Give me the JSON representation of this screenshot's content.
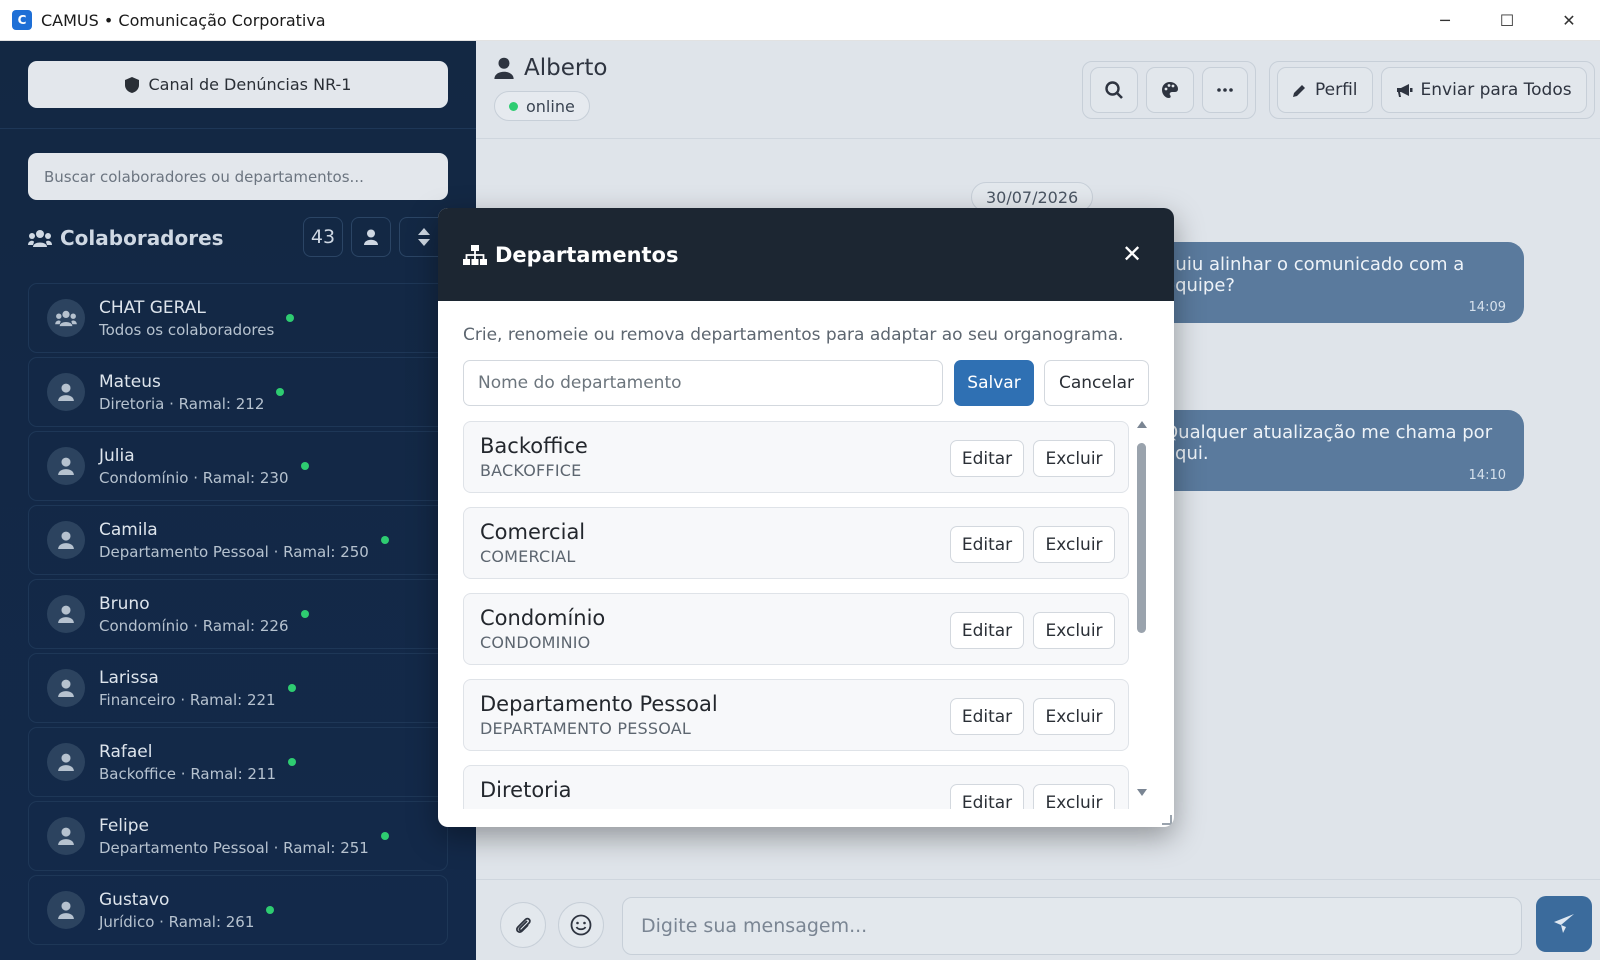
{
  "window": {
    "title": "CAMUS • Comunicação Corporativa",
    "logo_text": "C",
    "controls": {
      "minimize": "─",
      "maximize": "☐",
      "close": "✕"
    }
  },
  "sidebar": {
    "nr1_button": "Canal de Denúncias NR-1",
    "search_placeholder": "Buscar colaboradores ou departamentos...",
    "collab_title": "Colaboradores",
    "collab_count": "43",
    "contacts": [
      {
        "name": "CHAT GERAL",
        "sub": "Todos os colaboradores",
        "status": "online",
        "group": true
      },
      {
        "name": "Mateus",
        "sub": "Diretoria · Ramal: 212",
        "status": "online"
      },
      {
        "name": "Julia",
        "sub": "Condomínio · Ramal: 230",
        "status": "online"
      },
      {
        "name": "Camila",
        "sub": "Departamento Pessoal · Ramal: 250",
        "status": "online"
      },
      {
        "name": "Bruno",
        "sub": "Condomínio · Ramal: 226",
        "status": "online"
      },
      {
        "name": "Larissa",
        "sub": "Financeiro · Ramal: 221",
        "status": "online"
      },
      {
        "name": "Rafael",
        "sub": "Backoffice · Ramal: 211",
        "status": "online"
      },
      {
        "name": "Felipe",
        "sub": "Departamento Pessoal · Ramal: 251",
        "status": "online"
      },
      {
        "name": "Gustavo",
        "sub": "Jurídico · Ramal: 261",
        "status": "online"
      }
    ]
  },
  "chat": {
    "peer_name": "Alberto",
    "peer_status": "online",
    "toolbar": {
      "profile_label": "Perfil",
      "broadcast_label": "Enviar para Todos"
    },
    "date_label": "30/07/2026",
    "messages": [
      {
        "text": "guiu alinhar o comunicado com a equipe?",
        "time": "14:09"
      },
      {
        "text": "Qualquer atualização me chama por aqui.",
        "time": "14:10"
      }
    ],
    "composer_placeholder": "Digite sua mensagem..."
  },
  "modal": {
    "title": "Departamentos",
    "description": "Crie, renomeie ou remova departamentos para adaptar ao seu organograma.",
    "input_placeholder": "Nome do departamento",
    "save_label": "Salvar",
    "cancel_label": "Cancelar",
    "edit_label": "Editar",
    "delete_label": "Excluir",
    "departments": [
      {
        "name": "Backoffice",
        "code": "BACKOFFICE"
      },
      {
        "name": "Comercial",
        "code": "COMERCIAL"
      },
      {
        "name": "Condomínio",
        "code": "CONDOMINIO"
      },
      {
        "name": "Departamento Pessoal",
        "code": "DEPARTAMENTO PESSOAL"
      },
      {
        "name": "Diretoria",
        "code": ""
      }
    ]
  },
  "colors": {
    "sidebar_bg": "#132843",
    "modal_header": "#1c2632",
    "primary_button": "#2f70b3",
    "online_dot": "#2ecc71",
    "bubble": "#5a7a9d",
    "send_button": "#3b6b9c"
  }
}
